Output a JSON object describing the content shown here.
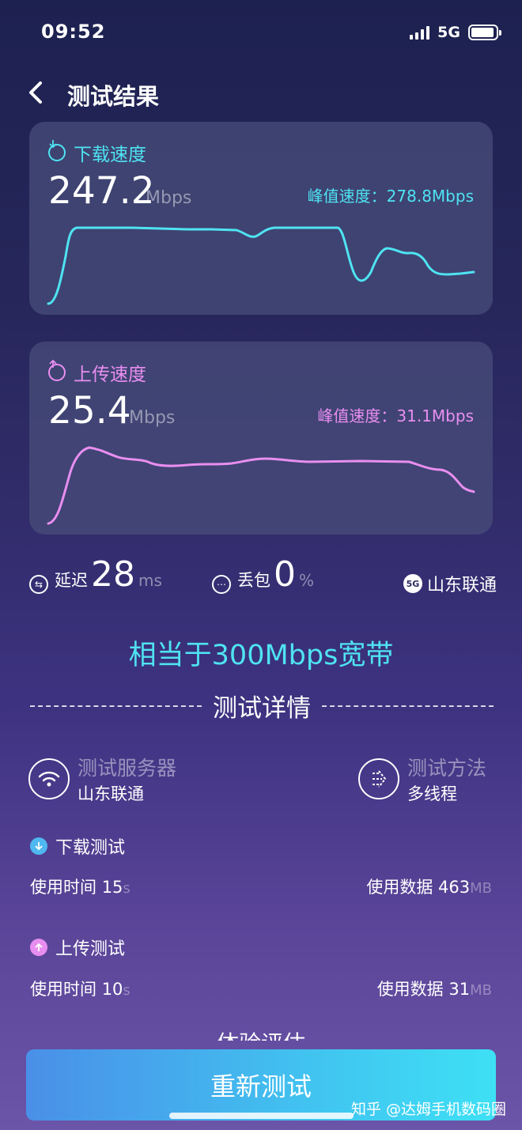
{
  "status_bar": {
    "time": "09:52",
    "network": "5G"
  },
  "header": {
    "title": "测试结果"
  },
  "download": {
    "label": "下载速度",
    "speed": "247.2",
    "unit": "Mbps",
    "peak_label": "峰值速度：278.8Mbps",
    "color": "#4fe3f2"
  },
  "upload": {
    "label": "上传速度",
    "speed": "25.4",
    "unit": "Mbps",
    "peak_label": "峰值速度：31.1Mbps",
    "color": "#e88ef0"
  },
  "stats": {
    "latency_label": "延迟",
    "latency_value": "28",
    "latency_unit": "ms",
    "loss_label": "丢包",
    "loss_value": "0",
    "loss_unit": "%",
    "carrier_badge": "5G",
    "carrier": "山东联通"
  },
  "equivalent": "相当于300Mbps宽带",
  "details": {
    "title": "测试详情",
    "server_label": "测试服务器",
    "server_value": "山东联通",
    "method_label": "测试方法",
    "method_value": "多线程",
    "download_test": {
      "title": "下载测试",
      "time_label": "使用时间",
      "time_value": "15",
      "time_unit": "s",
      "data_label": "使用数据",
      "data_value": "463",
      "data_unit": "MB"
    },
    "upload_test": {
      "title": "上传测试",
      "time_label": "使用时间",
      "time_value": "10",
      "time_unit": "s",
      "data_label": "使用数据",
      "data_value": "31",
      "data_unit": "MB"
    }
  },
  "next_section_partial": "体验评估",
  "retest_button": "重新测试",
  "watermark": "知乎 @达姆手机数码圈"
}
